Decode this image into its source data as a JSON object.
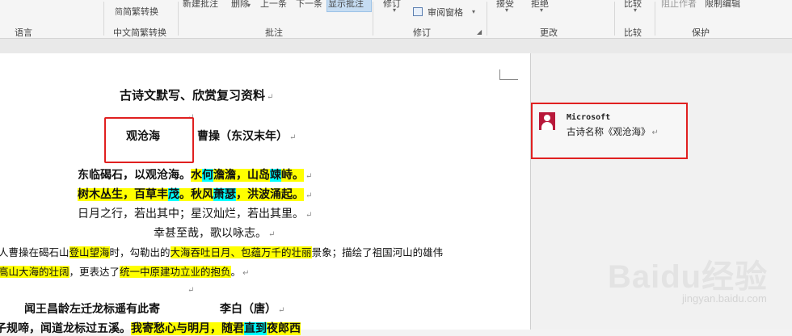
{
  "ribbon": {
    "language": {
      "group_label": "语言"
    },
    "chinese_conversion": {
      "button": "简繁转换",
      "group_label": "中文简繁转换"
    },
    "comments": {
      "new_comment": "新建批注",
      "delete": "删除",
      "previous": "上一条",
      "next": "下一条",
      "show_comments": "显示批注",
      "group_label": "批注"
    },
    "tracking": {
      "track_changes": "修订",
      "reviewing_pane": "审阅窗格",
      "group_label": "修订"
    },
    "changes": {
      "accept": "接受",
      "reject": "拒绝",
      "group_label": "更改"
    },
    "compare": {
      "compare": "比较",
      "group_label": "比较"
    },
    "protect": {
      "block_authors": "阻止作者",
      "restrict_editing": "限制编辑",
      "group_label": "保护"
    }
  },
  "document": {
    "title": "古诗文默写、欣赏复习资料",
    "poem1": {
      "title": "观沧海",
      "author": "曹操（东汉末年）",
      "l1_a": "东临碣石，以观沧海。",
      "l1_b": "水",
      "l1_c": "何",
      "l1_d": "澹澹",
      "l1_e": "，山岛",
      "l1_f": "竦",
      "l1_g": "峙。",
      "l2_a": "树木丛生，百草丰",
      "l2_b": "茂",
      "l2_c": "。秋风",
      "l2_d": "萧瑟",
      "l2_e": "，洪波涌起。",
      "l3": "日月之行，若出其中；星汉灿烂，若出其里。",
      "l4": "幸甚至哉，歌以咏志。",
      "note1_a": "人曹操在碣石山",
      "note1_b": "登山望海",
      "note1_c": "时，勾勒出的",
      "note1_d": "大海吞吐日月、包蕴万千的壮丽",
      "note1_e": "景象；描绘了祖国河山的雄伟",
      "note2_a": "高山大海的壮阔",
      "note2_b": "，更表达了",
      "note2_c": "统一中原建功立业的抱负",
      "note2_d": "。"
    },
    "poem2": {
      "title": "闻王昌龄左迁龙标遥有此寄",
      "author": "李白（唐）",
      "l1_a": "子规啼，闻道龙标过五溪。",
      "l1_b": "我寄愁心与明月，随君",
      "l1_c": "直到",
      "l1_d": "夜郎西"
    },
    "paragraph_mark": "↵"
  },
  "comment": {
    "author": "Microsoft",
    "text": "古诗名称《观沧海》"
  },
  "watermark": {
    "logo": "Baidu经验",
    "url": "jingyan.baidu.com"
  },
  "colors": {
    "highlight_yellow": "#ffff00",
    "highlight_cyan": "#00ffff",
    "annotation_red": "#e02020",
    "avatar": "#b8183a"
  },
  "icons": [
    "chinese-conversion-icon",
    "reviewing-pane-icon",
    "dialog-launcher-icon",
    "user-avatar-icon"
  ]
}
